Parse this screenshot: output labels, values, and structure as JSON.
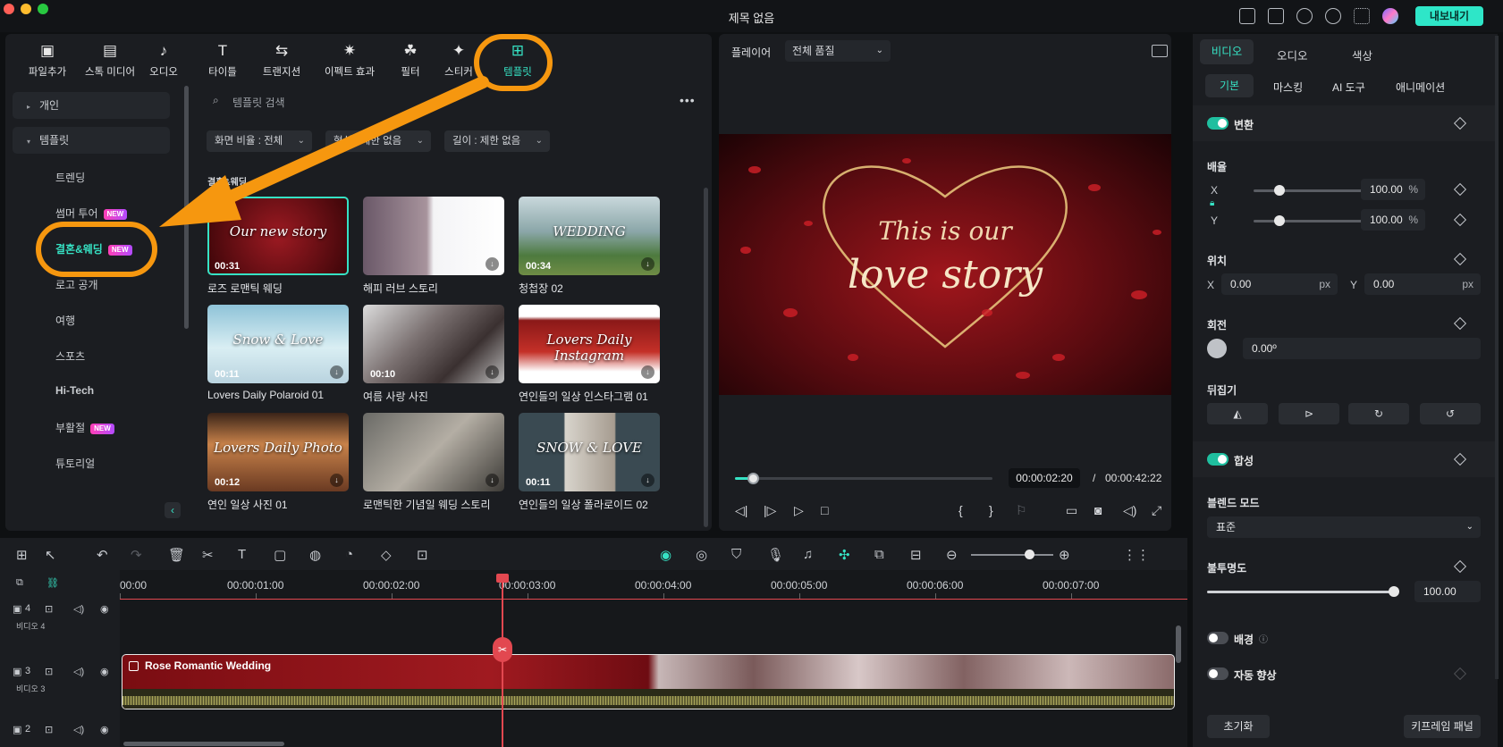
{
  "window": {
    "title": "제목 없음",
    "export_label": "내보내기"
  },
  "media_tabs": [
    {
      "label": "파일추가",
      "icon": "image-icon",
      "glyph": "▣"
    },
    {
      "label": "스톡 미디어",
      "icon": "stock-media-icon",
      "glyph": "▤"
    },
    {
      "label": "오디오",
      "icon": "music-icon",
      "glyph": "♪"
    },
    {
      "label": "타이틀",
      "icon": "text-icon",
      "glyph": "T"
    },
    {
      "label": "트랜지션",
      "icon": "transition-icon",
      "glyph": "⇆"
    },
    {
      "label": "이펙트 효과",
      "icon": "effects-icon",
      "glyph": "✷"
    },
    {
      "label": "필터",
      "icon": "filter-icon",
      "glyph": "☘"
    },
    {
      "label": "스티커",
      "icon": "sticker-icon",
      "glyph": "✦"
    },
    {
      "label": "템플릿",
      "icon": "template-icon",
      "glyph": "⊞"
    }
  ],
  "sidebar": {
    "groups": [
      {
        "label": "개인"
      },
      {
        "label": "템플릿"
      }
    ],
    "items": [
      {
        "label": "트렌딩",
        "new": false
      },
      {
        "label": "썸머 투어",
        "new": true
      },
      {
        "label": "결혼&웨딩",
        "new": true,
        "active": true
      },
      {
        "label": "로고 공개",
        "new": false
      },
      {
        "label": "여행",
        "new": false
      },
      {
        "label": "스포츠",
        "new": false
      },
      {
        "label": "Hi-Tech",
        "new": false
      },
      {
        "label": "부활절",
        "new": true
      },
      {
        "label": "튜토리얼",
        "new": false
      }
    ],
    "new_badge": "NEW"
  },
  "search": {
    "placeholder": "템플릿 검색"
  },
  "filters": [
    {
      "label": "화면 비율 : 전체"
    },
    {
      "label": "형식 : 제한 없음"
    },
    {
      "label": "길이 : 제한 없음"
    }
  ],
  "section_title": "결혼&웨딩",
  "templates": [
    {
      "title": "로즈 로맨틱 웨딩",
      "duration": "00:31",
      "bg": "radial-gradient(circle at 50% 50%,#9c1a22,#3a0508)",
      "text": "Our new story",
      "selected": true
    },
    {
      "title": "해피 러브 스토리",
      "duration": "",
      "bg": "linear-gradient(90deg,#6a5868 0%,#a7939c 45%,#f4f4f6 50%,#ffffff 100%)",
      "text": ""
    },
    {
      "title": "청첩장 02",
      "duration": "00:34",
      "bg": "linear-gradient(180deg,#c9d8dc 0%,#8aa6a8 45%,#4d7a3e 75%,#6f8c45 100%)",
      "text": "WEDDING"
    },
    {
      "title": "Lovers Daily Polaroid 01",
      "duration": "00:11",
      "bg": "linear-gradient(180deg,#8fc3d8 0%,#d9eef3 55%,#b9d3df 100%)",
      "text": "Snow & Love"
    },
    {
      "title": "여름 사랑 사진",
      "duration": "00:10",
      "bg": "linear-gradient(135deg,#dcdcdc 0%,#7a7070 40%,#3a3030 70%,#bdbdbd 100%)",
      "text": ""
    },
    {
      "title": "연인들의 일상 인스타그램 01",
      "duration": "",
      "bg": "linear-gradient(180deg,#ffffff 0%,#ffffff 15%,#8a1818 20%,#c43028 60%,#ffffff 85%)",
      "text": "Lovers Daily Instagram"
    },
    {
      "title": "연인 일상 사진 01",
      "duration": "00:12",
      "bg": "linear-gradient(180deg,#3a2418 0%,#c8824a 40%,#6a3a22 100%)",
      "text": "Lovers Daily Photo"
    },
    {
      "title": "로맨틱한 기념일 웨딩 스토리",
      "duration": "",
      "bg": "linear-gradient(135deg,#6a6a66 0%,#b4aea4 50%,#3c3a36 100%)",
      "text": ""
    },
    {
      "title": "연인들의 일상 폴라로이드 02",
      "duration": "00:11",
      "bg": "linear-gradient(90deg,#3a4a52 0%,#3a4a52 32%,#d8d4cc 33%,#a69c90 68%,#3a4a52 69%)",
      "text": "SNOW & LOVE"
    }
  ],
  "player": {
    "label": "플레이어",
    "quality": "전체 품질",
    "video_text_1": "This is our",
    "video_text_2": "love story",
    "current_time": "00:00:02:20",
    "total_time": "00:00:42:22",
    "progress": 0.07
  },
  "properties": {
    "tabs": [
      "비디오",
      "오디오",
      "색상"
    ],
    "subtabs": [
      "기본",
      "마스킹",
      "AI 도구",
      "애니메이션"
    ],
    "transform_label": "변환",
    "scale_label": "배율",
    "scale_x": "100.00",
    "scale_y": "100.00",
    "percent": "%",
    "position_label": "위치",
    "pos_x": "0.00",
    "pos_y": "0.00",
    "px": "px",
    "rotation_label": "회전",
    "rotation": "0.00º",
    "flip_label": "뒤집기",
    "composite_label": "합성",
    "blend_label": "블렌드 모드",
    "blend_value": "표준",
    "opacity_label": "불투명도",
    "opacity": "100.00",
    "background_label": "배경",
    "auto_enhance_label": "자동 향상",
    "reset_label": "초기화",
    "keyframe_label": "키프레임 패널",
    "x": "X",
    "y": "Y"
  },
  "timeline": {
    "ticks": [
      "00:00",
      "00:00:01:00",
      "00:00:02:00",
      "00:00:03:00",
      "00:00:04:00",
      "00:00:05:00",
      "00:00:06:00",
      "00:00:07:00"
    ],
    "tracks": [
      {
        "num": "4",
        "name": "비디오 4"
      },
      {
        "num": "3",
        "name": "비디오 3"
      },
      {
        "num": "2",
        "name": ""
      }
    ],
    "clip_title": "Rose Romantic Wedding"
  },
  "colors": {
    "accent": "#36e2c4",
    "annotation": "#f6970f",
    "playhead": "#e24850"
  }
}
